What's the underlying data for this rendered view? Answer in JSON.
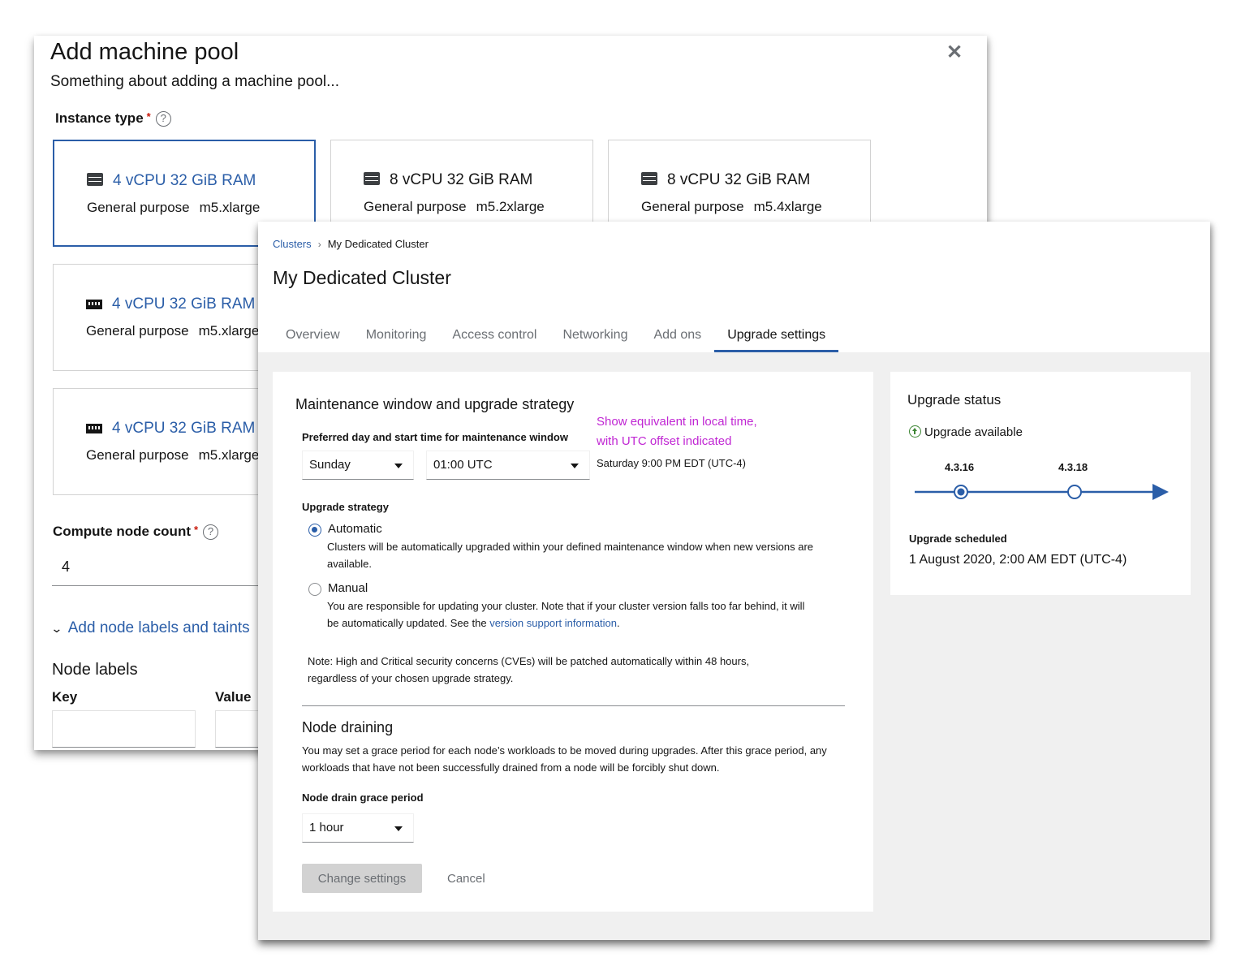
{
  "machine_pool": {
    "title": "Add machine pool",
    "subtitle": "Something about adding a machine pool...",
    "close_icon": "close-icon",
    "instance_type_label": "Instance type",
    "required_mark": "*",
    "help_glyph": "?",
    "instance_cards": [
      {
        "specs": "4 vCPU 32 GiB RAM",
        "category": "General purpose",
        "type": "m5.xlarge",
        "icon": "server-icon",
        "selected": true
      },
      {
        "specs": "8 vCPU 32 GiB RAM",
        "category": "General purpose",
        "type": "m5.2xlarge",
        "icon": "server-icon",
        "selected": false
      },
      {
        "specs": "8 vCPU 32 GiB RAM",
        "category": "General purpose",
        "type": "m5.4xlarge",
        "icon": "server-icon",
        "selected": false
      },
      {
        "specs": "4 vCPU 32 GiB RAM",
        "category": "General purpose",
        "type": "m5.xlarge",
        "icon": "memory-icon",
        "selected": false
      },
      {
        "specs": "4 vCPU 32 GiB RAM",
        "category": "General purpose",
        "type": "m5.xlarge",
        "icon": "memory-icon",
        "selected": false
      }
    ],
    "compute_node_count_label": "Compute node count",
    "compute_node_count_value": "4",
    "add_labels_toggle": "Add node labels and taints",
    "node_labels_title": "Node labels",
    "key_header": "Key",
    "value_header": "Value"
  },
  "cluster": {
    "breadcrumb": {
      "parent": "Clusters",
      "separator": "›",
      "current": "My Dedicated Cluster"
    },
    "title": "My Dedicated Cluster",
    "tabs": [
      "Overview",
      "Monitoring",
      "Access control",
      "Networking",
      "Add ons",
      "Upgrade settings"
    ],
    "active_tab": "Upgrade settings",
    "maintenance": {
      "title": "Maintenance window and upgrade strategy",
      "preferred_label": "Preferred day and start time for maintenance window",
      "local_time_note_line1": "Show equivalent in local time,",
      "local_time_note_line2": "with UTC offset indicated",
      "day_value": "Sunday",
      "time_value": "01:00 UTC",
      "local_time_value": "Saturday 9:00 PM EDT (UTC-4)",
      "strategy_label": "Upgrade strategy",
      "automatic_label": "Automatic",
      "automatic_desc": "Clusters will be automatically upgraded within your defined maintenance window when new versions are available.",
      "manual_label": "Manual",
      "manual_desc": "You are responsible for updating your cluster. Note that if your cluster version falls too far behind, it will be automatically updated. See the",
      "manual_link": "version support information",
      "manual_desc_end": ".",
      "selected_strategy": "Automatic",
      "note": "Note: High and Critical security concerns (CVEs) will be patched automatically within 48 hours, regardless of your chosen upgrade strategy."
    },
    "node_draining": {
      "title": "Node draining",
      "desc": "You may set a grace period for each node’s workloads to be moved during upgrades. After this grace period, any workloads that have not been successfully drained from a node will be forcibly shut down.",
      "grace_label": "Node drain grace period",
      "grace_value": "1 hour"
    },
    "buttons": {
      "change": "Change settings",
      "cancel": "Cancel"
    },
    "upgrade_status": {
      "title": "Upgrade status",
      "available_text": "Upgrade available",
      "current_version": "4.3.16",
      "target_version": "4.3.18",
      "scheduled_label": "Upgrade scheduled",
      "scheduled_value": "1 August 2020, 2:00 AM EDT (UTC-4)"
    }
  },
  "colors": {
    "accent": "#2b5ea8",
    "note_pink": "#c026d3",
    "available_green": "#3e8635",
    "required_red": "#c9190b"
  }
}
